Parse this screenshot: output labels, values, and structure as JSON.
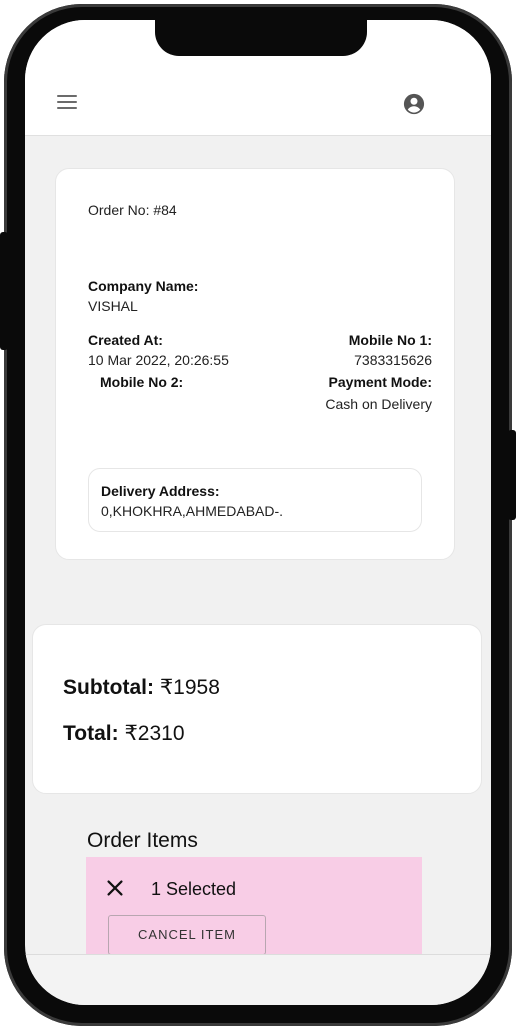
{
  "app_bar": {
    "menu_icon": "menu-icon",
    "account_icon": "account-circle-icon"
  },
  "order": {
    "order_no": "Order No: #84",
    "company_label": "Company Name:",
    "company_value": "VISHAL",
    "created_label": "Created At:",
    "created_value": "10 Mar 2022, 20:26:55",
    "mobile1_label": "Mobile No 1:",
    "mobile1_value": "7383315626",
    "mobile2_label": "Mobile No 2:",
    "payment_label": "Payment Mode:",
    "payment_value": "Cash on Delivery",
    "address_label": "Delivery Address:",
    "address_value": "0,KHOKHRA,AHMEDABAD-."
  },
  "totals": {
    "subtotal_label": "Subtotal:",
    "subtotal_value": " ₹1958",
    "total_label": "Total:",
    "total_value": " ₹2310"
  },
  "order_items": {
    "title": "Order Items",
    "close_icon": "close-icon",
    "selected_text": "1 Selected",
    "cancel_label": "CANCEL ITEM"
  },
  "colors": {
    "selection_bg": "#f8cde6",
    "screen_bg": "#f1f1f1",
    "card_bg": "#ffffff"
  }
}
